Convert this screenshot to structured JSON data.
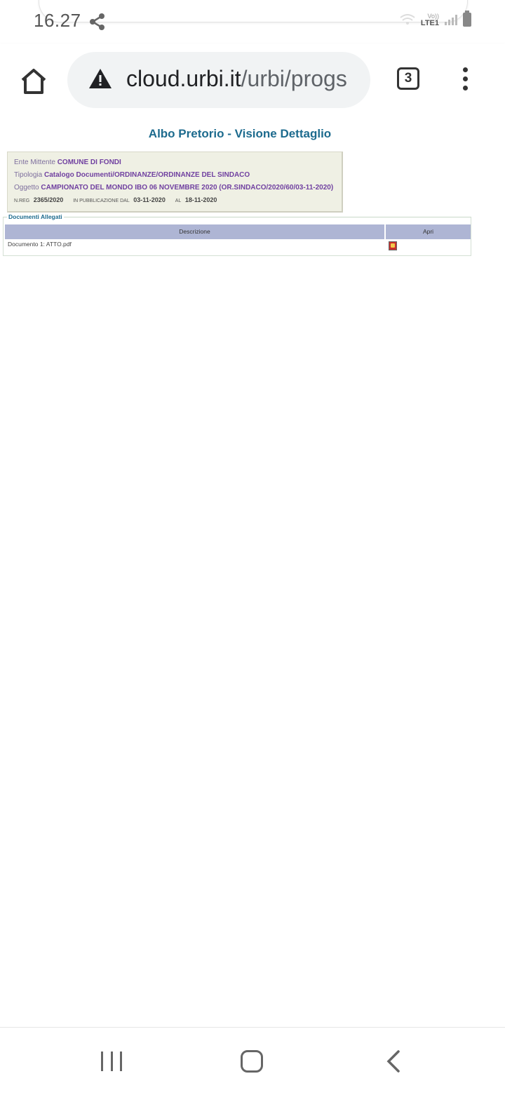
{
  "status_bar": {
    "time": "16.27",
    "network_label": "LTE1",
    "volte_label": "Vo))"
  },
  "browser": {
    "url_domain": "cloud.urbi.it",
    "url_path": "/urbi/progs",
    "tab_count": "3"
  },
  "page": {
    "title": "Albo Pretorio - Visione Dettaglio",
    "details": {
      "ente_label": "Ente Mittente",
      "ente_value": "COMUNE DI FONDI",
      "tipologia_label": "Tipologia",
      "tipologia_value": "Catalogo Documenti/ORDINANZE/ORDINANZE DEL SINDACO",
      "oggetto_label": "Oggetto",
      "oggetto_value": "CAMPIONATO DEL MONDO IBO 06 NOVEMBRE 2020 (OR.SINDACO/2020/60/03-11-2020)",
      "nreg_label": "N.REG",
      "nreg_value": "2365/2020",
      "pub_label": "IN PUBBLICAZIONE DAL",
      "pub_from": "03-11-2020",
      "al_label": "AL",
      "pub_to": "18-11-2020"
    },
    "attachments": {
      "legend": "Documenti Allegati",
      "col_descrizione": "Descrizione",
      "col_apri": "Apri",
      "rows": [
        {
          "descrizione": "Documento 1: ATTO.pdf"
        }
      ]
    }
  },
  "colors": {
    "title": "#1d6b8e",
    "info_bg": "#eff0e4",
    "table_header": "#aeb5d4",
    "value_purple": "#7040a0"
  }
}
